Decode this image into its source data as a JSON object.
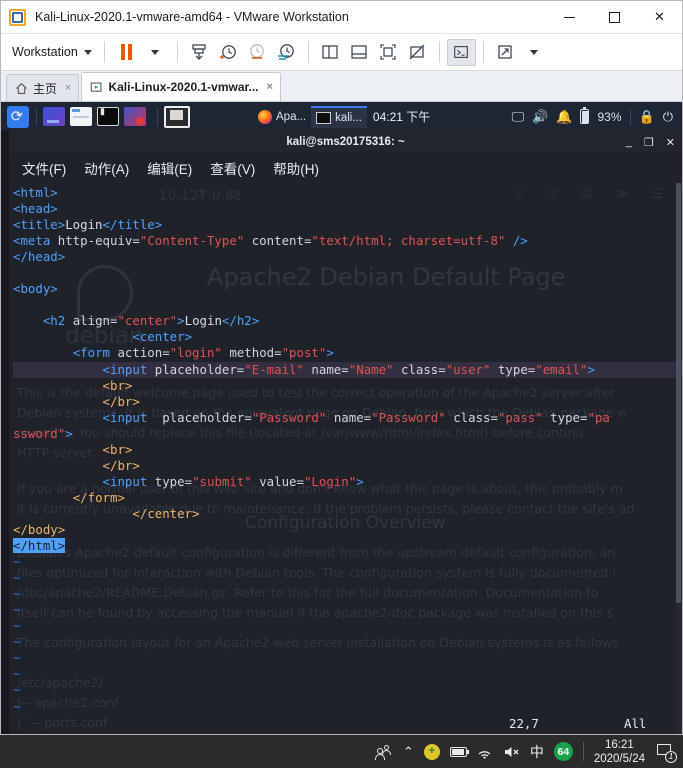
{
  "vmware": {
    "app_icon": "vmware-logo-icon",
    "title": "Kali-Linux-2020.1-vmware-amd64 - VMware Workstation",
    "window_controls": {
      "minimize": "minimize-icon",
      "maximize": "maximize-icon",
      "close": "close-icon"
    },
    "toolbar": {
      "menu_label": "Workstation",
      "buttons": [
        {
          "name": "pause-vm-button",
          "icon": "pause-icon"
        },
        {
          "name": "power-dropdown-button",
          "icon": "chevron-down-icon"
        },
        {
          "name": "send-ctrl-alt-del-button",
          "icon": "send-keys-icon"
        },
        {
          "name": "snapshot-take-button",
          "icon": "clock-plus-icon"
        },
        {
          "name": "snapshot-revert-button",
          "icon": "clock-revert-icon"
        },
        {
          "name": "snapshot-manager-button",
          "icon": "clock-manager-icon"
        },
        {
          "name": "show-library-button",
          "icon": "panel-left-icon"
        },
        {
          "name": "show-thumbnail-bar-button",
          "icon": "panel-bottom-icon"
        },
        {
          "name": "fullscreen-button",
          "icon": "fullscreen-icon"
        },
        {
          "name": "stretch-guest-button",
          "icon": "no-stretch-icon"
        },
        {
          "name": "console-view-button",
          "icon": "console-icon"
        },
        {
          "name": "unity-mode-button",
          "icon": "expand-arrow-icon"
        },
        {
          "name": "unity-dropdown-button",
          "icon": "chevron-down-icon"
        }
      ]
    },
    "tabs": [
      {
        "label": "主页",
        "icon": "home-icon",
        "active": false,
        "close": "×"
      },
      {
        "label": "Kali-Linux-2020.1-vmwar...",
        "icon": "vm-running-icon",
        "active": true,
        "close": "×"
      }
    ]
  },
  "kali_panel": {
    "logo": "kali-dragon-icon",
    "launchers": [
      {
        "name": "launcher-show-desktop",
        "icon": "workspace-icon"
      },
      {
        "name": "launcher-file-manager",
        "icon": "file-manager-icon"
      },
      {
        "name": "launcher-terminal",
        "icon": "terminal-icon"
      },
      {
        "name": "launcher-kali-apps",
        "icon": "kali-apps-icon"
      },
      {
        "name": "launcher-terminal-selected",
        "icon": "terminal-selected-icon"
      }
    ],
    "windows": [
      {
        "label": "Apa...",
        "icon": "firefox-icon",
        "active": false
      },
      {
        "label": "kali...",
        "icon": "terminal-icon",
        "active": true
      }
    ],
    "clock": "04:21 下午",
    "tray": {
      "display": "display-icon",
      "volume": "speaker-icon",
      "notifications": "bell-icon",
      "battery_icon": "battery-icon",
      "battery_text": "93%",
      "lock": "lock-icon",
      "logout": "power-logout-icon"
    }
  },
  "terminal": {
    "title": "kali@sms20175316: ~",
    "window_controls": {
      "minimize": "_",
      "maximize": "❐",
      "close": "✕"
    },
    "menus": [
      {
        "label": "文件(F)"
      },
      {
        "label": "动作(A)"
      },
      {
        "label": "编辑(E)"
      },
      {
        "label": "查看(V)"
      },
      {
        "label": "帮助(H)"
      }
    ],
    "editor": {
      "status_position": "22,7",
      "status_scroll": "All",
      "tilde_marker": "~",
      "tilde_count": 10,
      "lines": [
        {
          "i": 1,
          "hl": false,
          "seg": [
            {
              "t": "tg",
              "v": "<html>"
            }
          ]
        },
        {
          "i": 2,
          "hl": false,
          "seg": [
            {
              "t": "tg",
              "v": "<head>"
            }
          ]
        },
        {
          "i": 3,
          "hl": false,
          "seg": [
            {
              "t": "tg",
              "v": "<title>"
            },
            {
              "t": "tx",
              "v": "Login"
            },
            {
              "t": "tg",
              "v": "</title>"
            }
          ]
        },
        {
          "i": 4,
          "hl": false,
          "seg": [
            {
              "t": "tg",
              "v": "<meta "
            },
            {
              "t": "at",
              "v": "http-equiv="
            },
            {
              "t": "st",
              "v": "\"Content-Type\""
            },
            {
              "t": "at",
              "v": " content="
            },
            {
              "t": "st",
              "v": "\"text/html; charset=utf-8\""
            },
            {
              "t": "tg",
              "v": " />"
            }
          ]
        },
        {
          "i": 5,
          "hl": false,
          "seg": [
            {
              "t": "tg",
              "v": "</head>"
            }
          ]
        },
        {
          "i": 6,
          "hl": false,
          "seg": [
            {
              "t": "tx",
              "v": ""
            }
          ]
        },
        {
          "i": 7,
          "hl": false,
          "seg": [
            {
              "t": "tg",
              "v": "<body>"
            }
          ]
        },
        {
          "i": 8,
          "hl": false,
          "seg": [
            {
              "t": "tx",
              "v": ""
            }
          ]
        },
        {
          "i": 9,
          "hl": false,
          "seg": [
            {
              "t": "tx",
              "v": "    "
            },
            {
              "t": "tg",
              "v": "<h2 "
            },
            {
              "t": "at",
              "v": "align="
            },
            {
              "t": "st",
              "v": "\"center\""
            },
            {
              "t": "tg",
              "v": ">"
            },
            {
              "t": "tx",
              "v": "Login"
            },
            {
              "t": "tg",
              "v": "</h2>"
            }
          ]
        },
        {
          "i": 10,
          "hl": false,
          "seg": [
            {
              "t": "tx",
              "v": "                "
            },
            {
              "t": "tg",
              "v": "<center>"
            }
          ]
        },
        {
          "i": 11,
          "hl": false,
          "seg": [
            {
              "t": "tx",
              "v": "        "
            },
            {
              "t": "tg",
              "v": "<form "
            },
            {
              "t": "at",
              "v": "action="
            },
            {
              "t": "st",
              "v": "\"login\""
            },
            {
              "t": "at",
              "v": " method="
            },
            {
              "t": "st",
              "v": "\"post\""
            },
            {
              "t": "tg",
              "v": ">"
            }
          ]
        },
        {
          "i": 12,
          "hl": true,
          "seg": [
            {
              "t": "tx",
              "v": "            "
            },
            {
              "t": "tg",
              "v": "<input "
            },
            {
              "t": "at",
              "v": "placeholder="
            },
            {
              "t": "st",
              "v": "\"E-mail\""
            },
            {
              "t": "at",
              "v": " name="
            },
            {
              "t": "st",
              "v": "\"Name\""
            },
            {
              "t": "at",
              "v": " class="
            },
            {
              "t": "st",
              "v": "\"user\""
            },
            {
              "t": "at",
              "v": " type="
            },
            {
              "t": "st",
              "v": "\"email\""
            },
            {
              "t": "tg",
              "v": ">"
            }
          ]
        },
        {
          "i": 13,
          "hl": false,
          "seg": [
            {
              "t": "tx",
              "v": "            "
            },
            {
              "t": "tn",
              "v": "<br>"
            }
          ]
        },
        {
          "i": 14,
          "hl": false,
          "seg": [
            {
              "t": "tx",
              "v": "            "
            },
            {
              "t": "tn",
              "v": "</br>"
            }
          ]
        },
        {
          "i": 15,
          "hl": false,
          "seg": [
            {
              "t": "tx",
              "v": "            "
            },
            {
              "t": "tg",
              "v": "<input  "
            },
            {
              "t": "at",
              "v": "placeholder="
            },
            {
              "t": "st",
              "v": "\"Password\""
            },
            {
              "t": "at",
              "v": " name="
            },
            {
              "t": "st",
              "v": "\"Password\""
            },
            {
              "t": "at",
              "v": " class="
            },
            {
              "t": "st",
              "v": "\"pass\""
            },
            {
              "t": "at",
              "v": " type="
            },
            {
              "t": "st",
              "v": "\"pa"
            }
          ]
        },
        {
          "i": 16,
          "hl": false,
          "seg": [
            {
              "t": "st",
              "v": "ssword\""
            },
            {
              "t": "tg",
              "v": ">"
            }
          ]
        },
        {
          "i": 17,
          "hl": false,
          "seg": [
            {
              "t": "tx",
              "v": "            "
            },
            {
              "t": "tn",
              "v": "<br>"
            }
          ]
        },
        {
          "i": 18,
          "hl": false,
          "seg": [
            {
              "t": "tx",
              "v": "            "
            },
            {
              "t": "tn",
              "v": "</br>"
            }
          ]
        },
        {
          "i": 19,
          "hl": false,
          "seg": [
            {
              "t": "tx",
              "v": "            "
            },
            {
              "t": "tg",
              "v": "<input "
            },
            {
              "t": "at",
              "v": "type="
            },
            {
              "t": "st",
              "v": "\"submit\""
            },
            {
              "t": "at",
              "v": " value="
            },
            {
              "t": "st",
              "v": "\"Login\""
            },
            {
              "t": "tg",
              "v": ">"
            }
          ]
        },
        {
          "i": 20,
          "hl": false,
          "seg": [
            {
              "t": "tx",
              "v": "        "
            },
            {
              "t": "tn",
              "v": "</form>"
            }
          ]
        },
        {
          "i": 21,
          "hl": false,
          "seg": [
            {
              "t": "tx",
              "v": "                "
            },
            {
              "t": "tn",
              "v": "</center>"
            }
          ]
        },
        {
          "i": 22,
          "hl": false,
          "seg": [
            {
              "t": "tn",
              "v": "</body>"
            }
          ]
        },
        {
          "i": 23,
          "hl": false,
          "cursor": true,
          "seg": [
            {
              "t": "tn",
              "v": "</html>"
            }
          ]
        }
      ]
    }
  },
  "ghost_page": {
    "url": "10.127.0.61",
    "heading": "Apache2 Debian Default Page",
    "logo_word": "debian",
    "paragraphs": [
      "This is the default welcome page used to test the correct operation of the Apache2 server after",
      "Debian systems. It is based on the equivalent page on Debian, from which the Debian package w",
      "sword\">. You should replace this file (located at /var/www/html/index.html) before continu",
      "HTTP server.",
      "If you are a normal user of this web site and don't know what this page is about, this probably m",
      "it is currently unavailable due to maintenance. If the problem persists, please contact the site's ad"
    ],
    "section_heading": "Configuration Overview",
    "paragraphs2": [
      "Debian's Apache2 default configuration is different from the upstream default configuration, an",
      "files optimized for interaction with Debian tools. The configuration system is fully documented i",
      "/doc/apache2/README.Debian.gz. Refer to this for the full documentation. Documentation fo",
      "itself can be found by accessing the manual if the apache2-doc package was installed on this s",
      "The configuration layout for an Apache2 web server installation on Debian systems is as follows",
      "/etc/apache2/",
      "|-- apache2.conf",
      "|       `--  ports.conf"
    ]
  },
  "windows_taskbar": {
    "people_icon": "people-icon",
    "show_hidden_icon": "chevron-up-icon",
    "tray": [
      {
        "name": "security-update-icon",
        "glyph": "+"
      },
      {
        "name": "battery-icon"
      },
      {
        "name": "wifi-icon"
      },
      {
        "name": "volume-muted-icon"
      },
      {
        "name": "ime-language-icon",
        "label": "中"
      },
      {
        "name": "app-badge-64",
        "label": "64"
      }
    ],
    "clock_time": "16:21",
    "clock_date": "2020/5/24",
    "notification_count": "1",
    "notification_icon": "action-center-icon"
  },
  "colors": {
    "vmware_accent": "#e8590c",
    "kali_panel": "#1f2633",
    "terminal_bg": "#21242c",
    "tag_blue": "#4ea1ff",
    "tag_orange": "#f0b46a",
    "string_red": "#e05252",
    "taskbar": "#2b2b2b"
  }
}
